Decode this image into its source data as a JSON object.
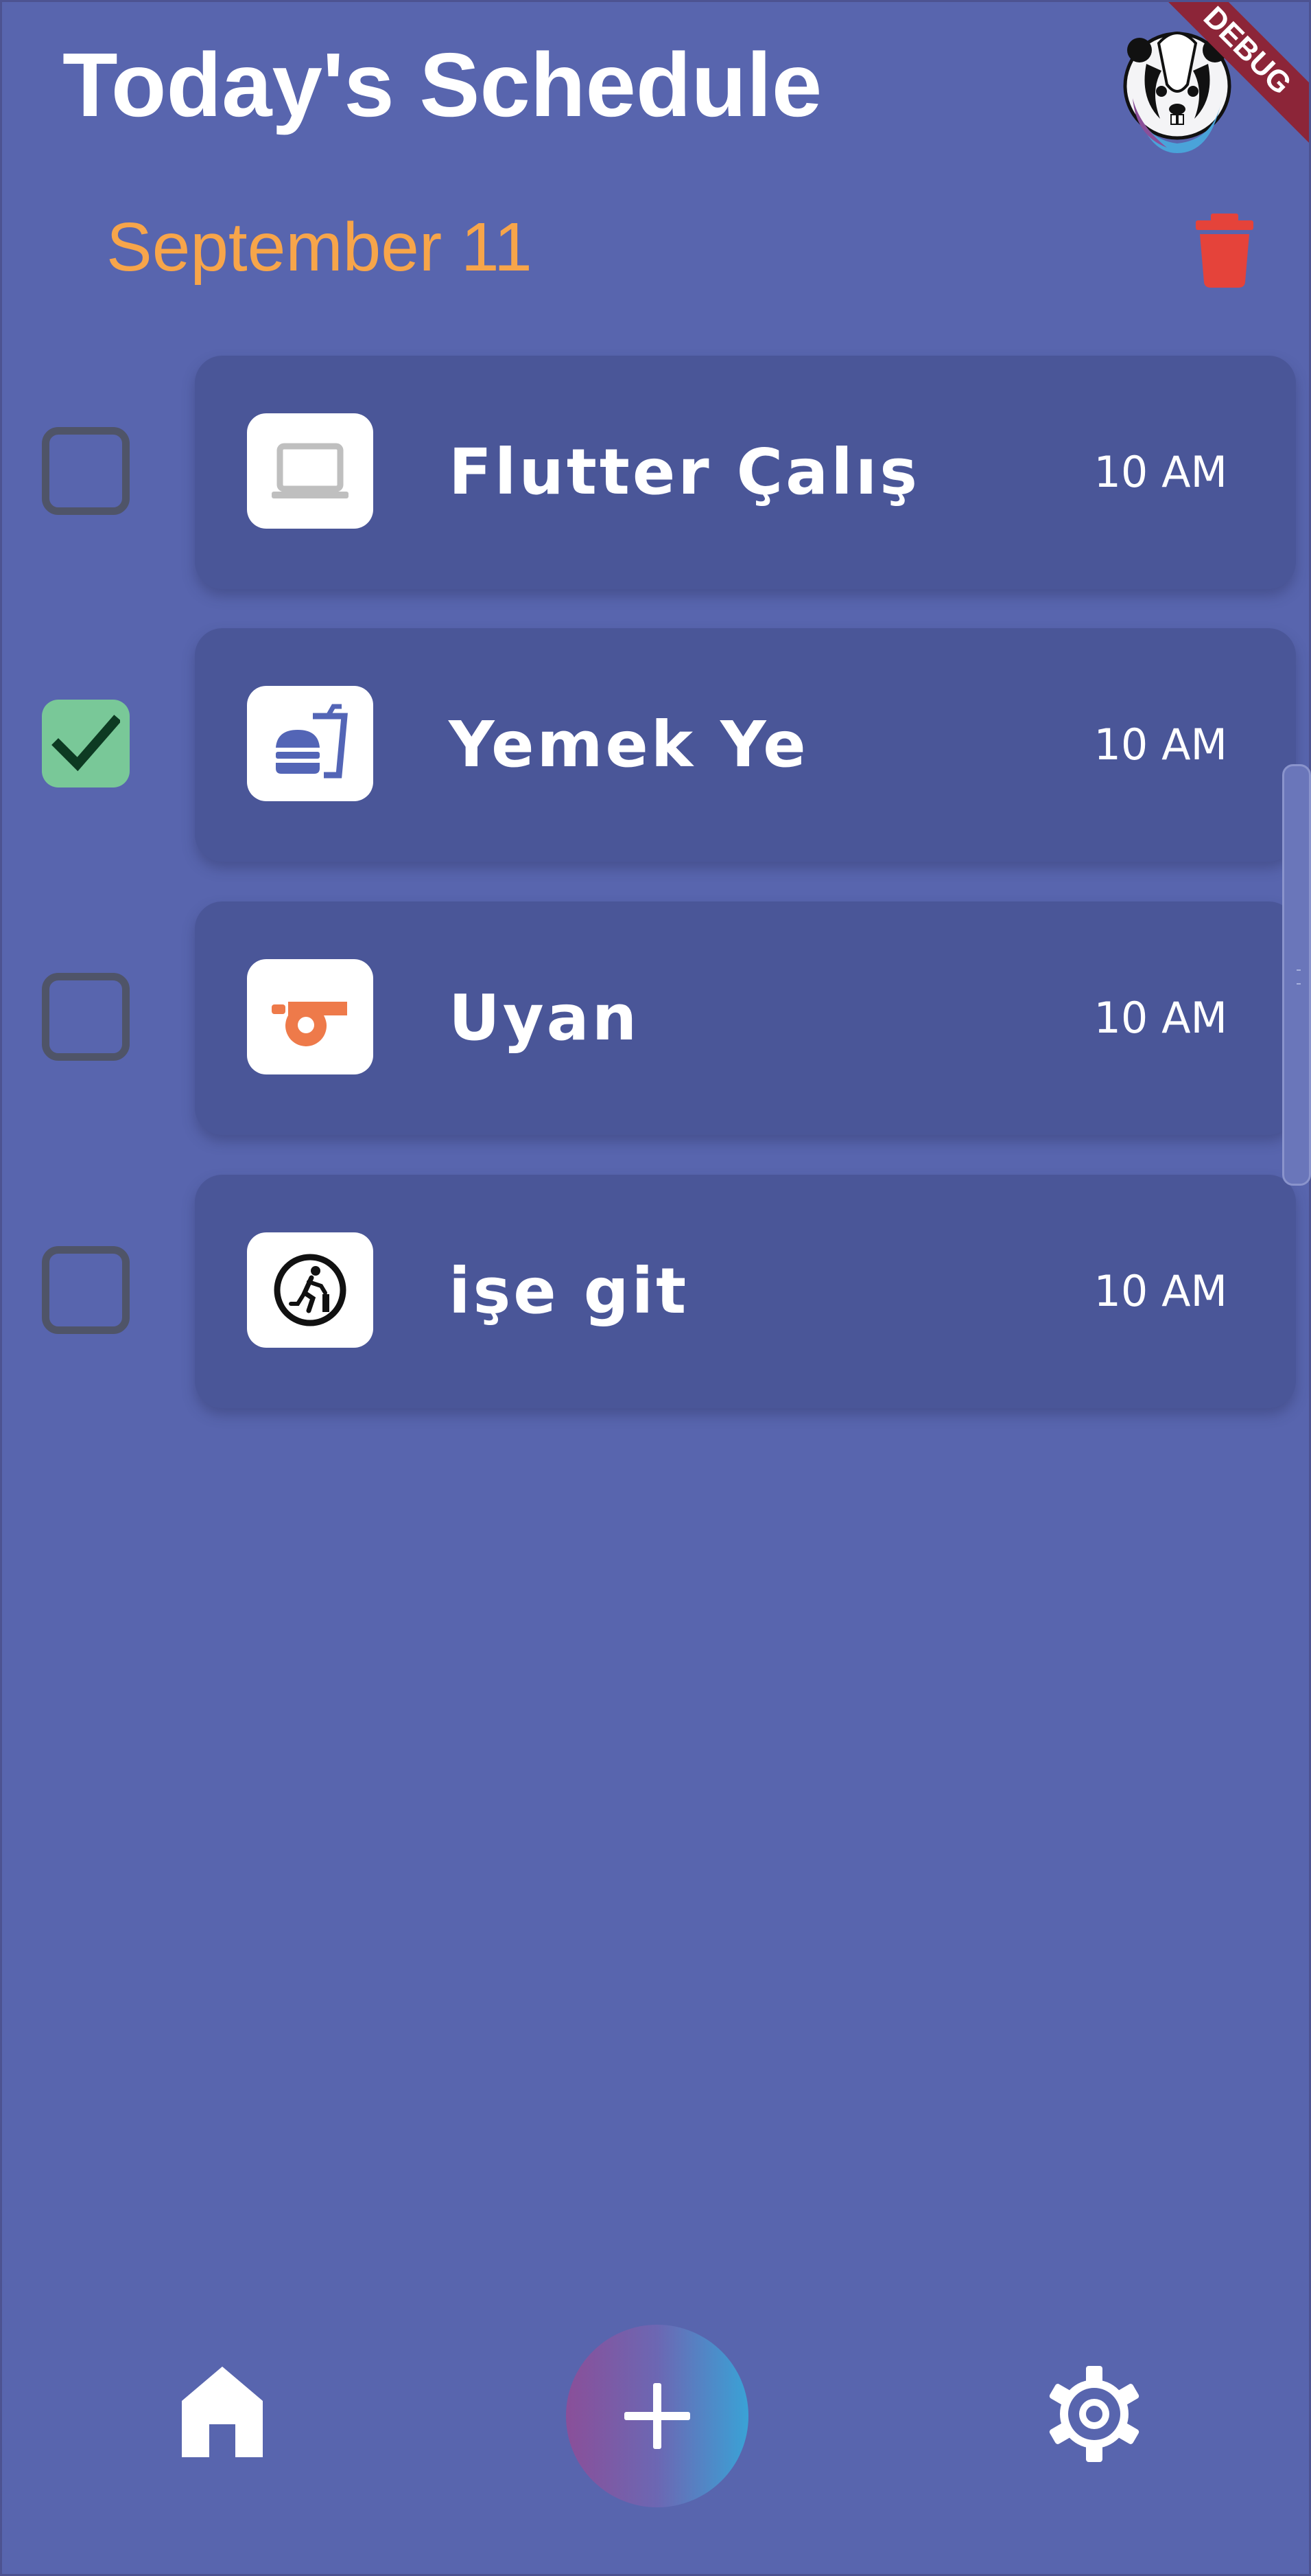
{
  "header": {
    "title": "Today's Schedule",
    "debug_banner": "DEBUG",
    "avatar_icon": "skunk-avatar-icon"
  },
  "date_row": {
    "date": "September 11",
    "delete_icon": "trash-icon",
    "date_color": "#f7a54a",
    "delete_color": "#e5433a"
  },
  "tasks": [
    {
      "title": "Flutter Çalış",
      "time": "10 AM",
      "icon": "laptop-icon",
      "checked": false
    },
    {
      "title": "Yemek Ye",
      "time": "10 AM",
      "icon": "fastfood-icon",
      "checked": true
    },
    {
      "title": "Uyan",
      "time": "10 AM",
      "icon": "whistle-icon",
      "checked": false
    },
    {
      "title": "işe git",
      "time": "10 AM",
      "icon": "running-exit-icon",
      "checked": false
    }
  ],
  "bottom_nav": {
    "home_icon": "home-icon",
    "add_icon": "plus-icon",
    "settings_icon": "gear-icon"
  },
  "colors": {
    "background": "#5865ae",
    "card": "#4a5698",
    "check_green": "#79c898",
    "fab_gradient_start": "#8a4f99",
    "fab_gradient_end": "#3aa2d6"
  }
}
